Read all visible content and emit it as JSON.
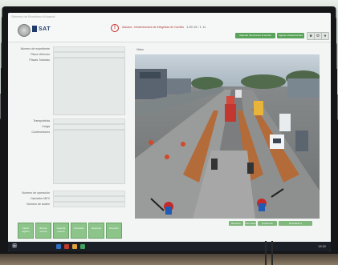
{
  "app": {
    "browser_title": "Sistema de Monitoreo Aduanal",
    "brand": "SAT",
    "warning_text": "Aduana - Infraestructura de Integridad de Carriles",
    "clock": "1:33 15 / 1 11",
    "header_buttons": [
      "Adjuntar documento al evento",
      "Ingreso Infraestructura"
    ],
    "header_icons": [
      "camera-icon",
      "settings-icon",
      "user-icon",
      "logout-icon"
    ]
  },
  "form": {
    "top_labels": [
      "Número de expediente",
      "Placa Vehículo",
      "Placas Traslado"
    ],
    "mid_labels": [
      "Transportista",
      "Carga",
      "Contenedores"
    ],
    "bottom_labels": [
      "Número de operación",
      "Operador MEX",
      "Número de andén"
    ]
  },
  "video": {
    "label": "Video",
    "buttons": [
      "Reportar",
      "Información",
      "Inspección",
      "Resultado 2"
    ]
  },
  "bottom_buttons": [
    "Iniciar registro",
    "Buscar evento",
    "Guardar evento",
    "Consultar",
    "Reportes",
    "Revisión"
  ],
  "taskbar": {
    "clock": "13:32"
  },
  "colors": {
    "accent_green": "#5aa35a",
    "brand_blue": "#1e3b6b",
    "warning_red": "#c62828",
    "taskbar": "#1b1f27"
  }
}
